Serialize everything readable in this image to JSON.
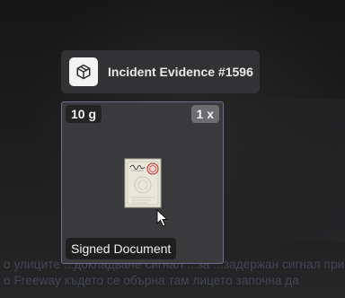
{
  "background": {
    "line1": "о улицитe ...докладванe сигнал ...за ...задeржан сигнал при",
    "line2": "о Freeway където се обърна там лицето започна да",
    "line3": ""
  },
  "header": {
    "icon": "package-icon",
    "title": "Incident Evidence #1596"
  },
  "item": {
    "weight": "10 g",
    "count": "1 x",
    "name": "Signed Document",
    "image": "signed-document-icon"
  },
  "colors": {
    "card_border": "#6e6f92",
    "header_bg": "#343436",
    "card_bg": "#3a3a3c"
  }
}
